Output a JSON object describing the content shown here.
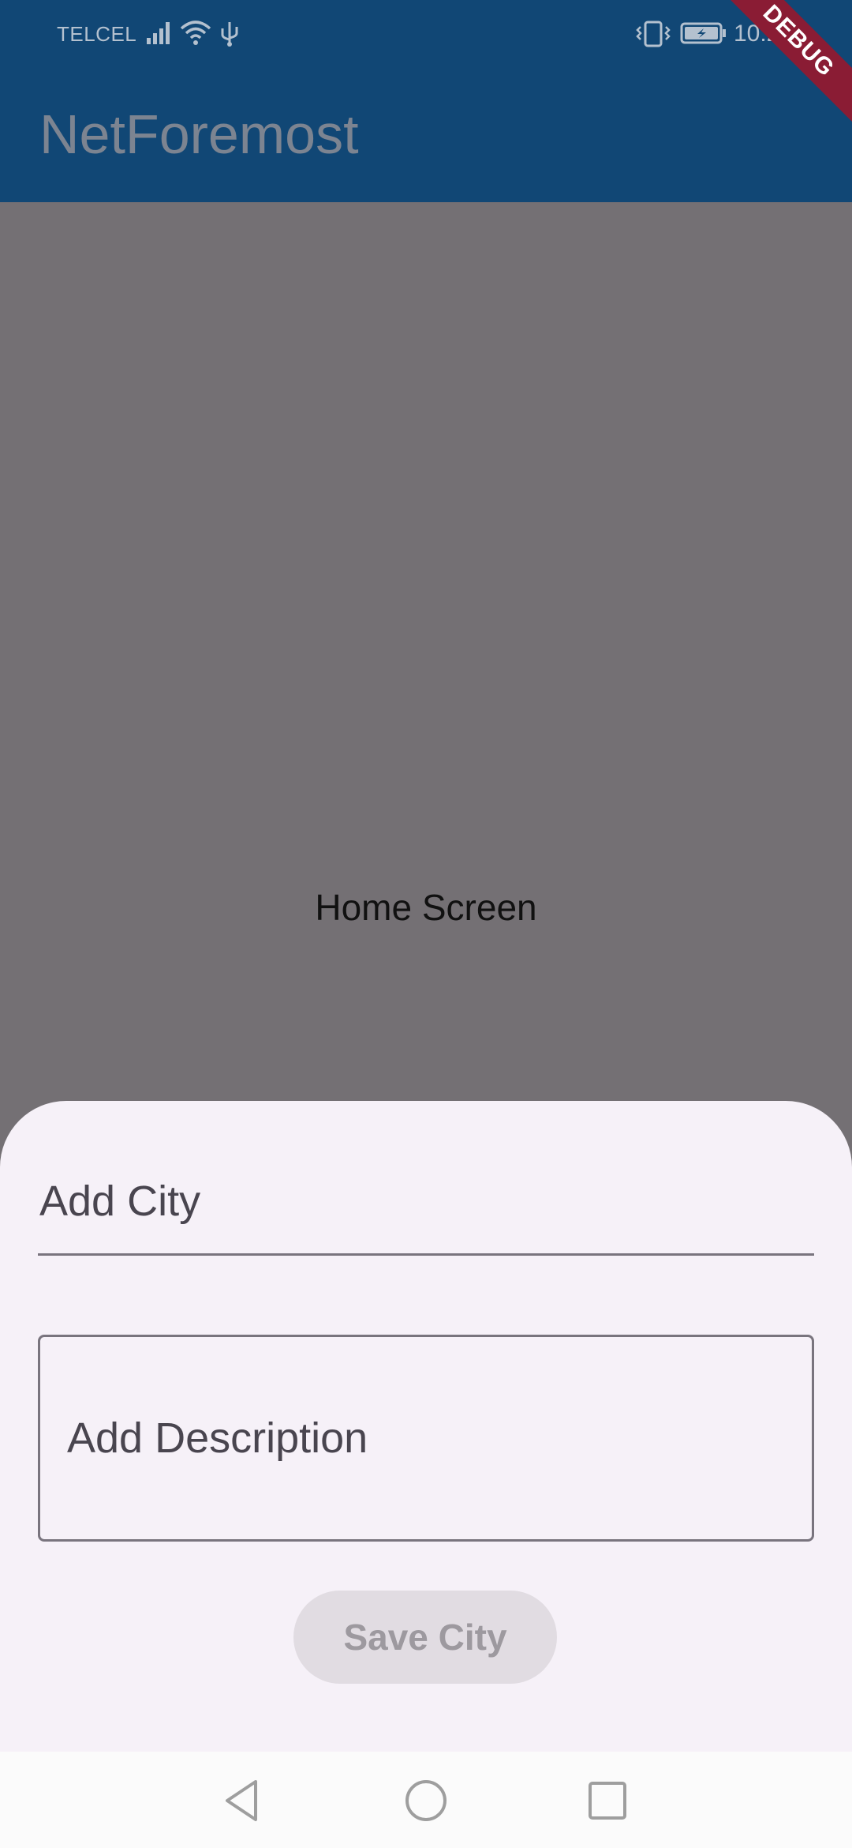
{
  "status_bar": {
    "carrier": "TELCEL",
    "time": "10:22",
    "icons": [
      "signal-icon",
      "wifi-icon",
      "usb-icon",
      "vibrate-icon",
      "battery-icon"
    ]
  },
  "debug_banner": "DEBUG",
  "app_bar": {
    "title": "NetForemost",
    "color": "#114775"
  },
  "body": {
    "label": "Home Screen"
  },
  "sheet": {
    "city_placeholder": "Add City",
    "city_value": "",
    "description_placeholder": "Add Description",
    "description_value": "",
    "save_label": "Save City"
  },
  "nav_bar": {
    "icons": [
      "back-icon",
      "home-icon",
      "recent-apps-icon"
    ]
  }
}
